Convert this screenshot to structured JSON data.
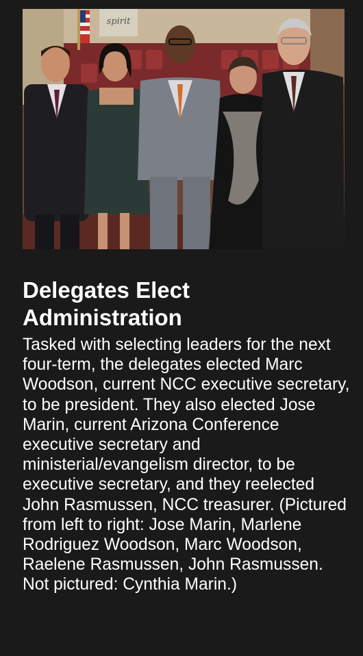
{
  "article": {
    "headline": "Delegates Elect Administration",
    "body": "Tasked with selecting leaders for the next four-term, the delegates elected Marc Woodson, current NCC executive secretary, to be president. They also elected Jose Marin, current Arizona Conference executive secretary and ministerial/evangelism director, to be executive secretary, and they reelected John Rasmussen, NCC treasurer. (Pictured from left to right: Jose Marin, Marlene Rodriguez Woodson, Marc Woodson, Raelene Rasmussen, John Rasmussen. Not pictured: Cynthia Marin.)"
  },
  "photo": {
    "banner_text": "spirit"
  },
  "colors": {
    "background": "#1a1a1a",
    "text": "#ffffff"
  }
}
